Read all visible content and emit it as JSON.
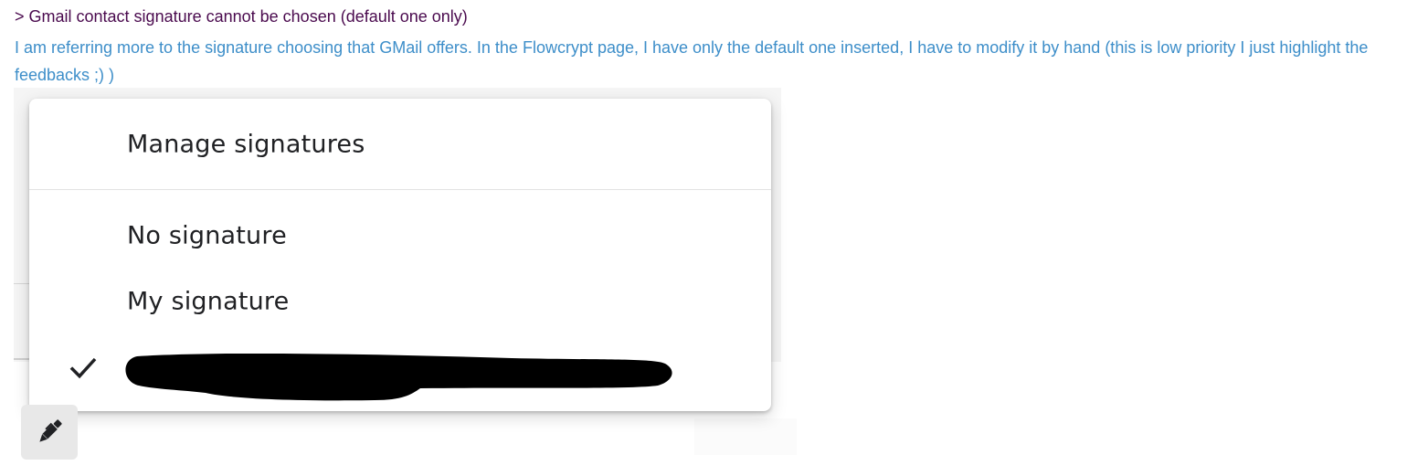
{
  "quote": {
    "text": "> Gmail contact signature cannot be chosen (default one only)"
  },
  "reply": {
    "text": "I am referring more to the signature choosing that GMail offers. In the Flowcrypt page, I have only the default one inserted, I have to modify it by hand (this is low priority I just highlight the feedbacks ;) )"
  },
  "signature_menu": {
    "manage_label": "Manage signatures",
    "items": [
      {
        "label": "No signature",
        "selected": false
      },
      {
        "label": "My signature",
        "selected": false
      },
      {
        "label": "",
        "selected": true,
        "redacted": true
      }
    ]
  },
  "icons": {
    "selected_marker": "check-icon",
    "signature_button": "pen-icon"
  },
  "colors": {
    "quote_text": "#4a0a4e",
    "reply_text": "#3d8ec9",
    "menu_text": "#202124",
    "redaction": "#000000"
  }
}
